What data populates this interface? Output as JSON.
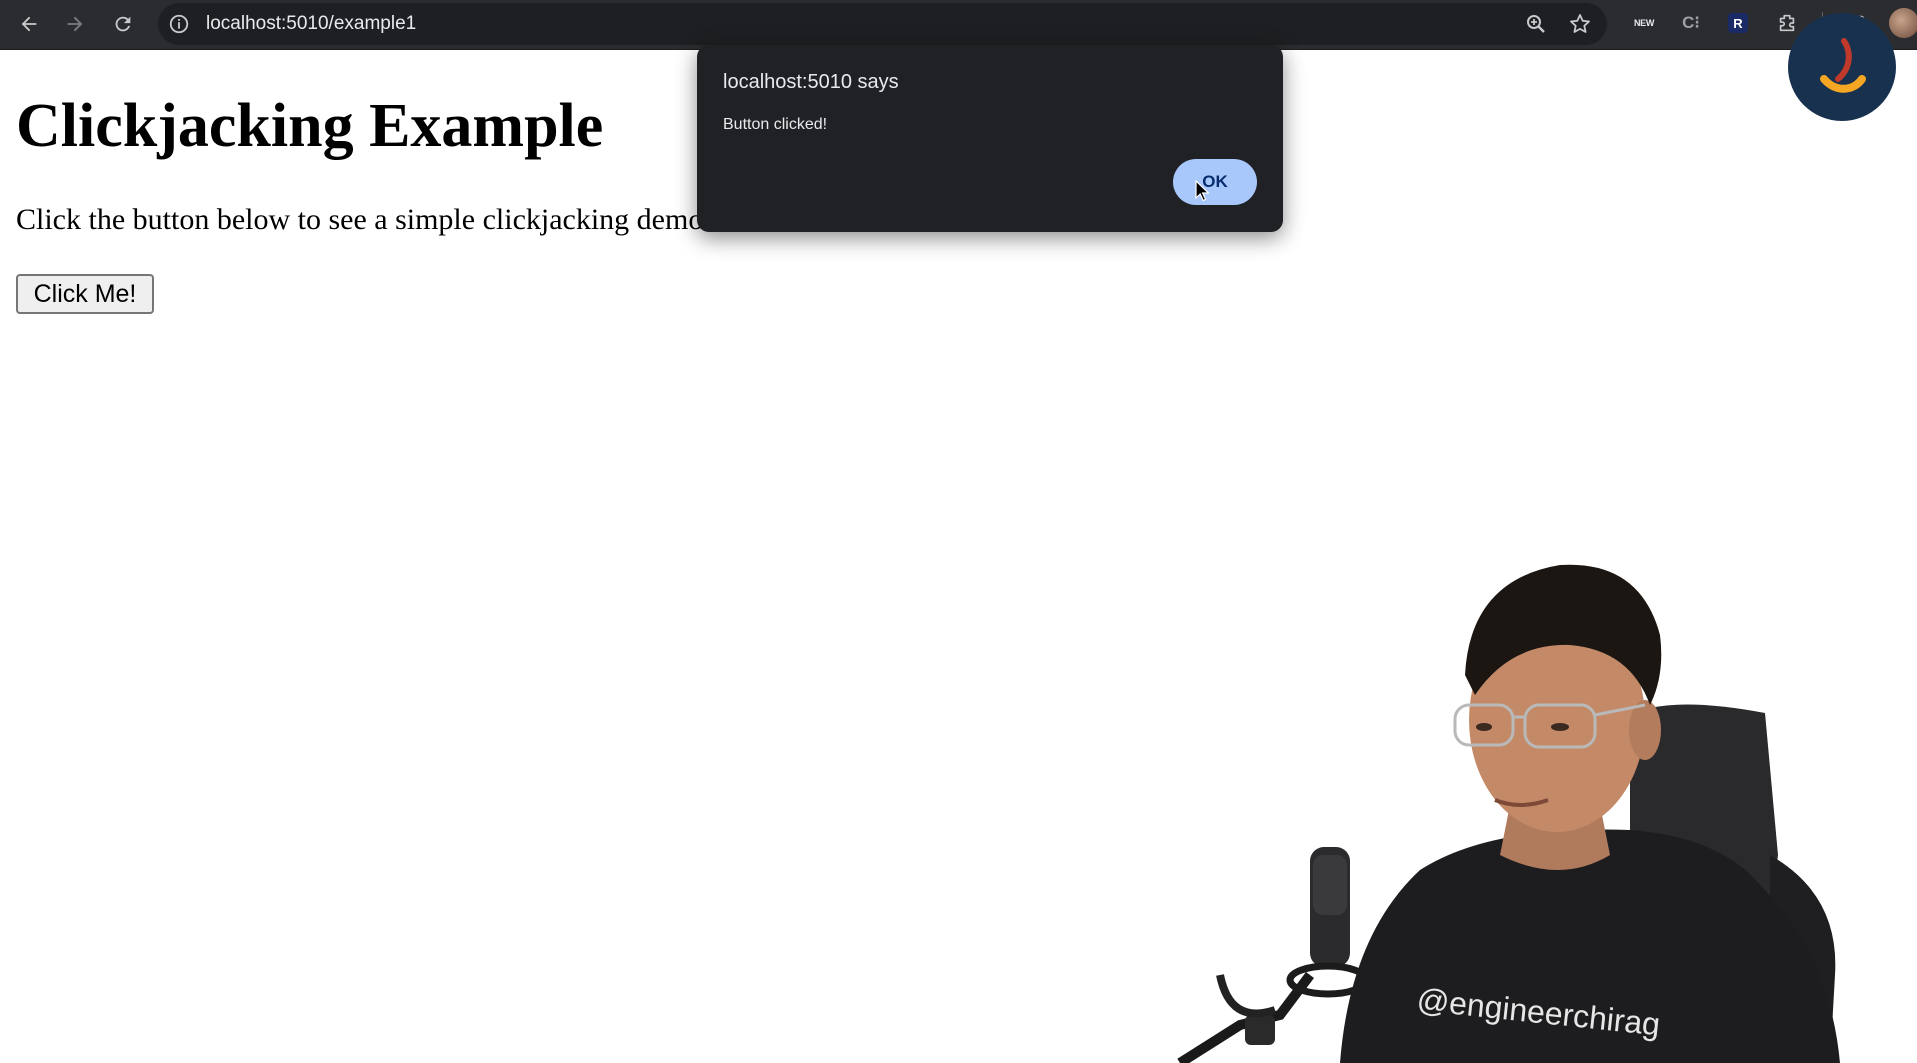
{
  "browser": {
    "url": "localhost:5010/example1",
    "extensions": {
      "new_badge": "NEW",
      "r_badge": "R"
    }
  },
  "page": {
    "title": "Clickjacking Example",
    "description": "Click the button below to see a simple clickjacking demonstration.",
    "button_label": "Click Me!"
  },
  "dialog": {
    "title": "localhost:5010 says",
    "message": "Button clicked!",
    "ok_label": "OK"
  },
  "webcam": {
    "shirt_text": "@engineerchirag"
  },
  "colors": {
    "toolbar": "#2b2c2f",
    "omnibox": "#1e1f22",
    "dialog_bg": "#202124",
    "ok_button": "#a8c7fa",
    "logo_bg": "#17314f",
    "logo_accent": "#f5a623"
  }
}
